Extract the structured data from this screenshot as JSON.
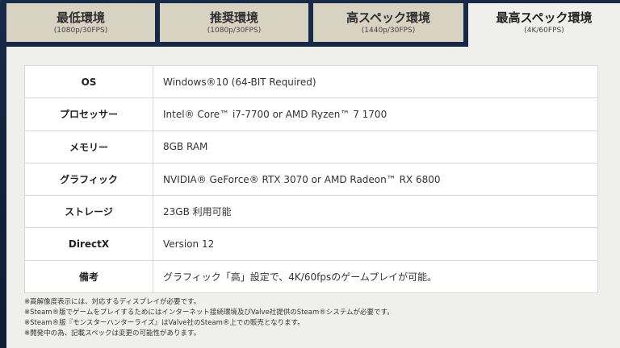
{
  "tabs": [
    {
      "title": "最低環境",
      "sub": "(1080p/30FPS)"
    },
    {
      "title": "推奨環境",
      "sub": "(1080p/30FPS)"
    },
    {
      "title": "高スペック環境",
      "sub": "(1440p/30FPS)"
    },
    {
      "title": "最高スペック環境",
      "sub": "(4K/60FPS)"
    }
  ],
  "active_tab": 3,
  "specs": [
    {
      "label": "OS",
      "value": "Windows®10 (64-BIT Required)"
    },
    {
      "label": "プロセッサー",
      "value": "Intel® Core™ i7-7700 or AMD Ryzen™ 7 1700"
    },
    {
      "label": "メモリー",
      "value": "8GB RAM"
    },
    {
      "label": "グラフィック",
      "value": "NVIDIA® GeForce® RTX 3070 or AMD Radeon™ RX 6800"
    },
    {
      "label": "ストレージ",
      "value": "23GB 利用可能"
    },
    {
      "label": "DirectX",
      "value": "Version 12"
    },
    {
      "label": "備考",
      "value": "グラフィック「高」設定で、4K/60fpsのゲームプレイが可能。"
    }
  ],
  "notes": [
    "※高解像度表示には、対応するディスプレイが必要です。",
    "※Steam®版でゲームをプレイするためにはインターネット接続環境及びValve社提供のSteam®システムが必要です。",
    "※Steam®版『モンスターハンターライズ』はValve社のSteam®上での販売となります。",
    "※開発中の為、記載スペックは変更の可能性があります。"
  ]
}
